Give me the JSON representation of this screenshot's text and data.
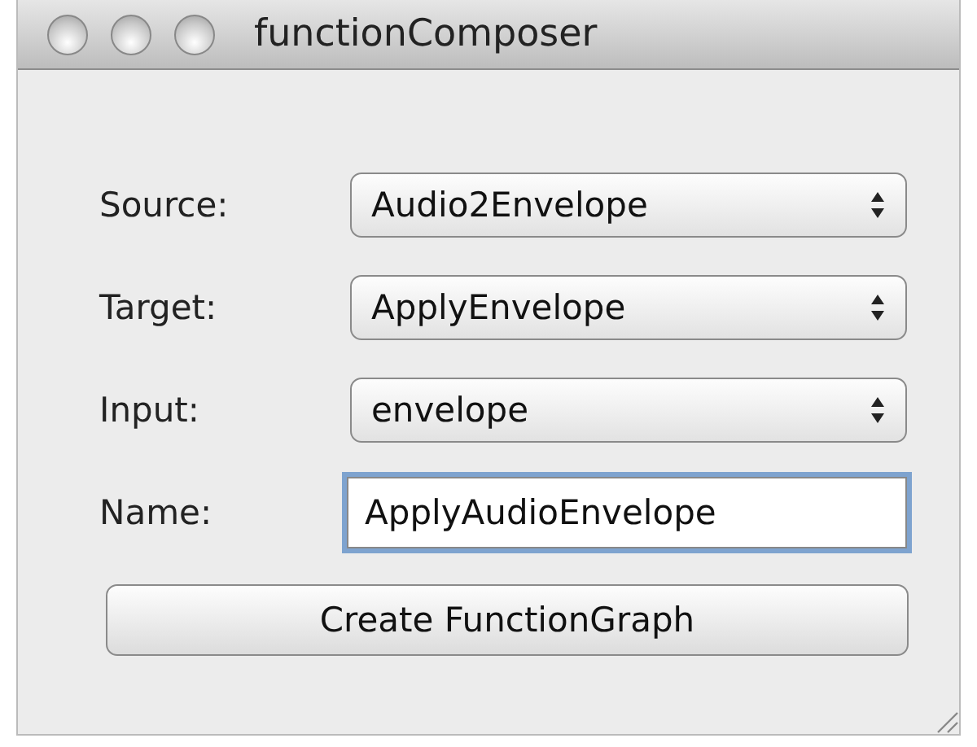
{
  "window": {
    "title": "functionComposer"
  },
  "fields": [
    {
      "kind": "popup",
      "label": "Source:",
      "value": "Audio2Envelope"
    },
    {
      "kind": "popup",
      "label": "Target:",
      "value": "ApplyEnvelope"
    },
    {
      "kind": "popup",
      "label": "Input:",
      "value": "envelope"
    },
    {
      "kind": "text",
      "label": "Name:",
      "value": "ApplyAudioEnvelope",
      "focused": true
    }
  ],
  "button": {
    "label": "Create FunctionGraph"
  }
}
